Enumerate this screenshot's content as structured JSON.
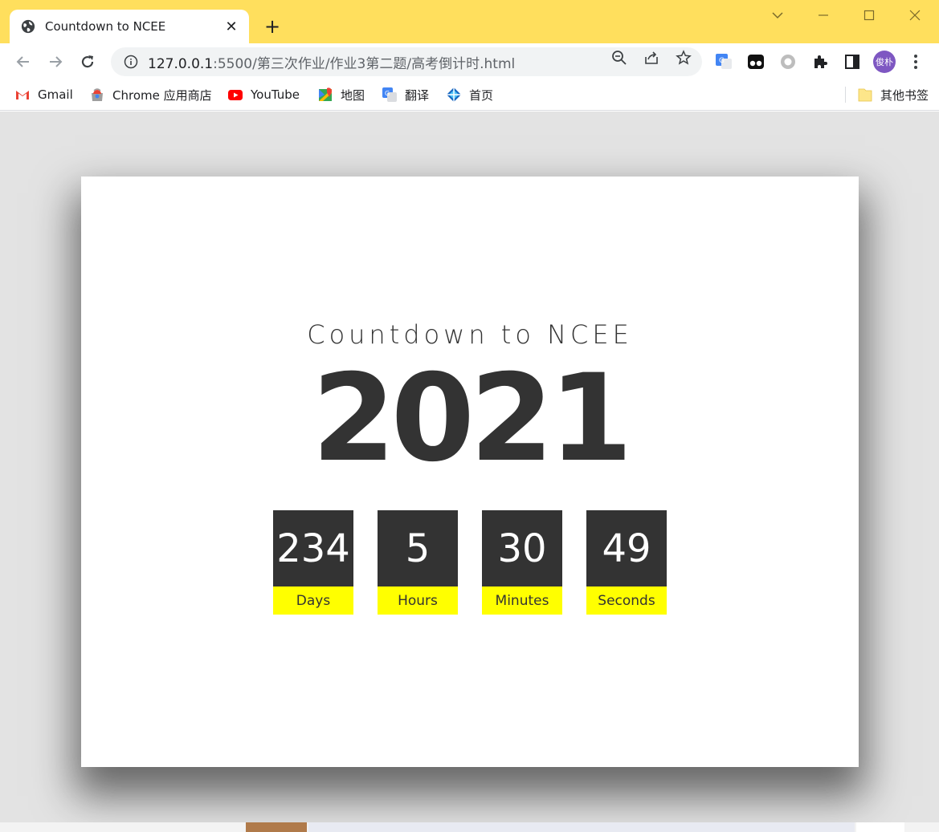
{
  "browser": {
    "tab": {
      "title": "Countdown to NCEE",
      "icon": "globe-icon",
      "close": "✕"
    },
    "new_tab": "+",
    "url": {
      "host": "127.0.0.1",
      "rest": ":5500/第三次作业/作业3第二题/高考倒计时.html"
    },
    "avatar_text": "俊朴"
  },
  "bookmarks": {
    "items": [
      {
        "label": "Gmail",
        "icon": "gmail-icon"
      },
      {
        "label": "Chrome 应用商店",
        "icon": "chrome-webstore-icon"
      },
      {
        "label": "YouTube",
        "icon": "youtube-icon"
      },
      {
        "label": "地图",
        "icon": "maps-icon"
      },
      {
        "label": "翻译",
        "icon": "translate-icon"
      },
      {
        "label": "首页",
        "icon": "home-site-icon"
      }
    ],
    "other": {
      "label": "其他书签",
      "icon": "folder-icon"
    }
  },
  "page": {
    "heading": "Countdown to NCEE",
    "year": "2021",
    "counters": [
      {
        "value": "234",
        "unit": "Days"
      },
      {
        "value": "5",
        "unit": "Hours"
      },
      {
        "value": "30",
        "unit": "Minutes"
      },
      {
        "value": "49",
        "unit": "Seconds"
      }
    ]
  },
  "colors": {
    "titlebar": "#ffdf5d",
    "page_bg": "#e3e3e3",
    "card_bg": "#ffffff",
    "text_dark": "#333333",
    "counter_bg": "#333333",
    "unit_bg": "#ffff00"
  }
}
